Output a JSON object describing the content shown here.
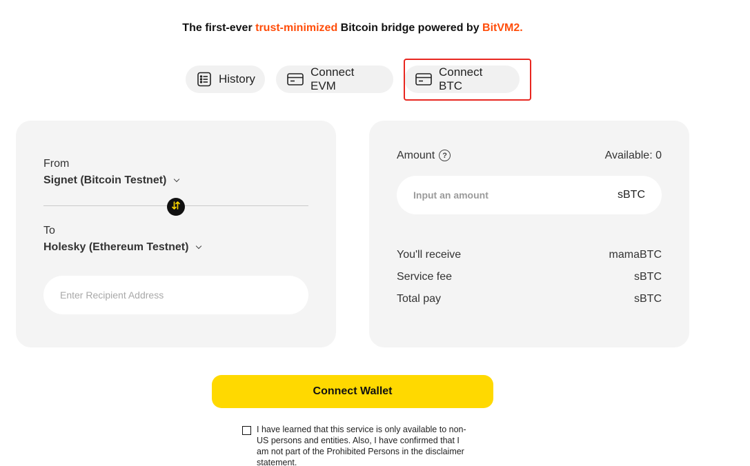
{
  "tagline": {
    "part1": "The first-ever ",
    "accent1": "trust-minimized",
    "part2": " Bitcoin bridge powered by ",
    "accent2": "BitVM2."
  },
  "top_buttons": {
    "history": "History",
    "connect_evm": "Connect EVM",
    "connect_btc": "Connect BTC"
  },
  "route": {
    "from_label": "From",
    "from_network": "Signet (Bitcoin Testnet)",
    "to_label": "To",
    "to_network": "Holesky (Ethereum Testnet)",
    "recipient_placeholder": "Enter Recipient Address",
    "recipient_value": ""
  },
  "amount": {
    "label": "Amount",
    "help_icon": "?",
    "available": "Available: 0",
    "placeholder": "Input an amount",
    "unit": "sBTC",
    "rows": [
      {
        "label": "You'll receive",
        "value": "mamaBTC"
      },
      {
        "label": "Service fee",
        "value": "sBTC"
      },
      {
        "label": "Total pay",
        "value": "sBTC"
      }
    ]
  },
  "cta": {
    "label": "Connect Wallet"
  },
  "disclaimer": {
    "checked": false,
    "text": "I have learned that this service is only available to non-US persons and entities. Also, I have confirmed that I am not part of the Prohibited Persons in the disclaimer statement."
  },
  "colors": {
    "accent": "#ff4d0a",
    "cta": "#ffd900",
    "highlight": "#e8261f",
    "card": "#f4f4f4"
  },
  "icons": {
    "history": "list-icon",
    "evm": "wallet-card-icon",
    "btc": "wallet-card-icon",
    "swap": "swap-arrows-icon",
    "dropdown": "chevron-down-icon",
    "help": "question-circle-icon"
  }
}
